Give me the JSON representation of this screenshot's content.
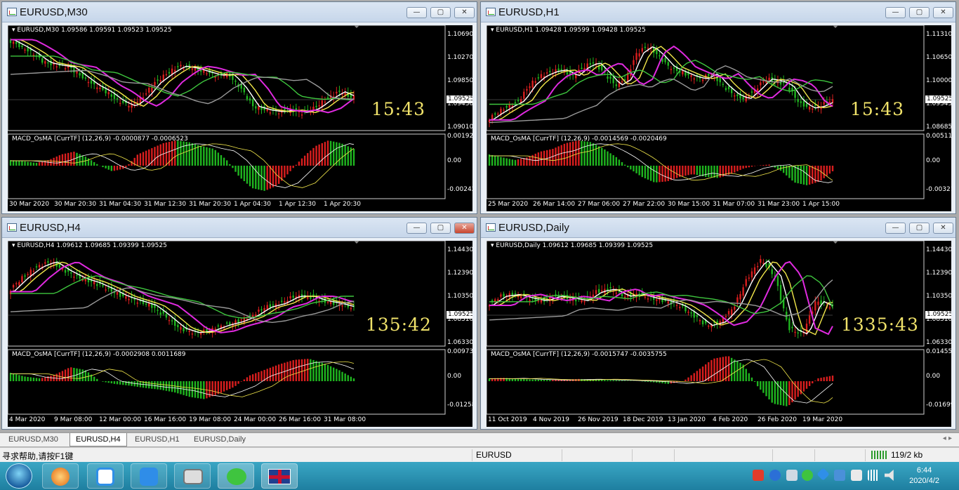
{
  "windows": [
    {
      "title": "EURUSD,M30",
      "header": "EURUSD,M30  1.09586 1.09591 1.09523 1.09525",
      "timer": "15:43",
      "prices": [
        "1.10690",
        "1.10270",
        "1.09850",
        "1.09430",
        "1.09010"
      ],
      "current": "1.09525",
      "macd_label": "MACD_OsMA [CurrTF] (12,26,9) -0.0000877 -0.0006523",
      "macd_scale": [
        "0.0019227",
        "0.00",
        "-0.002427"
      ],
      "times": [
        "30 Mar 2020",
        "30 Mar 20:30",
        "31 Mar 04:30",
        "31 Mar 12:30",
        "31 Mar 20:30",
        "1 Apr 04:30",
        "1 Apr 12:30",
        "1 Apr 20:30"
      ],
      "btns": {
        "min": "—",
        "max": "▢",
        "close": "✕"
      }
    },
    {
      "title": "EURUSD,H1",
      "header": "EURUSD,H1  1.09428 1.09599 1.09428 1.09525",
      "timer": "15:43",
      "prices": [
        "1.11310",
        "1.10650",
        "1.10000",
        "1.09345",
        "1.08685"
      ],
      "current": "1.09525",
      "macd_label": "MACD_OsMA [CurrTF] (12,26,9) -0.0014569 -0.0020469",
      "macd_scale": [
        "0.0051116",
        "0.00",
        "-0.003213"
      ],
      "times": [
        "25 Mar 2020",
        "26 Mar 14:00",
        "27 Mar 06:00",
        "27 Mar 22:00",
        "30 Mar 15:00",
        "31 Mar 07:00",
        "31 Mar 23:00",
        "1 Apr 15:00"
      ],
      "btns": {
        "min": "—",
        "max": "▢",
        "close": "✕"
      }
    },
    {
      "title": "EURUSD,H4",
      "header": "EURUSD,H4  1.09612 1.09685 1.09399 1.09525",
      "timer": "135:42",
      "prices": [
        "1.14430",
        "1.12390",
        "1.10350",
        "1.08310",
        "1.06330"
      ],
      "current": "1.09525",
      "macd_label": "MACD_OsMA [CurrTF] (12,26,9) -0.0002908 0.0011689",
      "macd_scale": [
        "0.0097318",
        "0.00",
        "-0.012587"
      ],
      "times": [
        "4 Mar 2020",
        "9 Mar 08:00",
        "12 Mar 00:00",
        "16 Mar 16:00",
        "19 Mar 08:00",
        "24 Mar 00:00",
        "26 Mar 16:00",
        "31 Mar 08:00"
      ],
      "btns": {
        "min": "—",
        "max": "▢",
        "close": "✕"
      }
    },
    {
      "title": "EURUSD,Daily",
      "header": "EURUSD,Daily  1.09612 1.09685 1.09399 1.09525",
      "timer": "1335:43",
      "prices": [
        "1.14430",
        "1.12390",
        "1.10350",
        "1.08310",
        "1.06330"
      ],
      "current": "1.09525",
      "macd_label": "MACD_OsMA [CurrTF] (12,26,9) -0.0015747 -0.0035755",
      "macd_scale": [
        "0.0145509",
        "0.00",
        "-0.016995"
      ],
      "times": [
        "11 Oct 2019",
        "4 Nov 2019",
        "26 Nov 2019",
        "18 Dec 2019",
        "13 Jan 2020",
        "4 Feb 2020",
        "26 Feb 2020",
        "19 Mar 2020"
      ],
      "btns": {
        "min": "—",
        "max": "▢",
        "close": "✕"
      }
    }
  ],
  "tabs": [
    "EURUSD,M30",
    "EURUSD,H4",
    "EURUSD,H1",
    "EURUSD,Daily"
  ],
  "active_tab": "EURUSD,H4",
  "status": {
    "help": "寻求帮助,请按F1键",
    "symbol": "EURUSD",
    "traffic": "119/2 kb"
  },
  "clock": {
    "time": "6:44",
    "date": "2020/4/2"
  },
  "colors": {
    "bull": "#d91e1e",
    "bear": "#1fb51f",
    "ma_white": "#ffffff",
    "ma_yellow": "#f3e84b",
    "ma_magenta": "#e02ae0",
    "ma_green": "#3ec63e",
    "ma_gray": "#9a9a9a",
    "timer": "#f0e26a"
  },
  "taskbar_icons": [
    "start-orb-icon",
    "phoenix-browser-icon",
    "baidu-netdisk-icon",
    "pen-app-icon",
    "camera-app-icon",
    "wechat-icon",
    "uk-flag-icon"
  ]
}
